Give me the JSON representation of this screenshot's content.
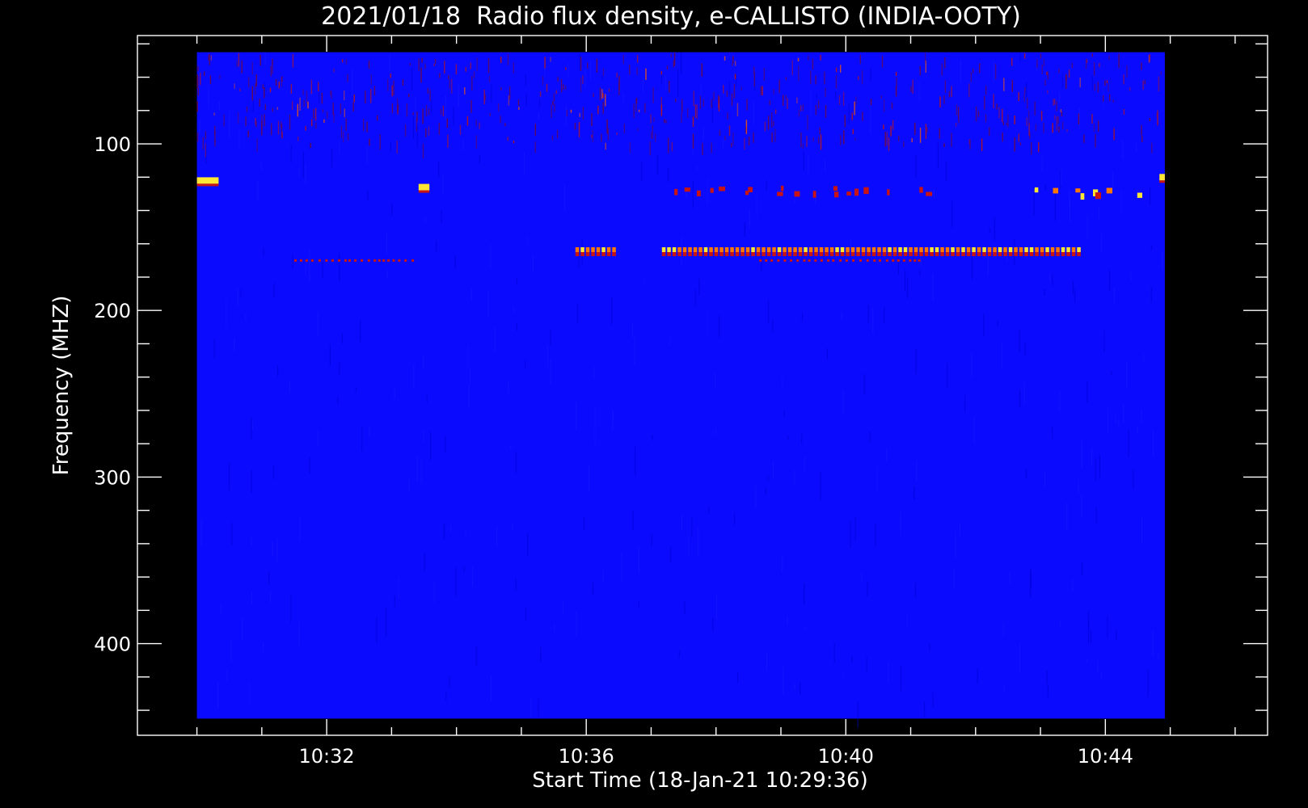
{
  "chart_data": {
    "type": "heatmap",
    "title": "2021/01/18  Radio flux density, e-CALLISTO (INDIA-OOTY)",
    "xlabel": "Start Time (18-Jan-21 10:29:36)",
    "ylabel": "Frequency (MHZ)",
    "x_unit": "UT time",
    "x_data_range": [
      "10:30:00",
      "10:44:55"
    ],
    "xlim": [
      "10:29:05",
      "10:46:30"
    ],
    "x_major_ticks": [
      "10:32",
      "10:36",
      "10:40",
      "10:44"
    ],
    "y_data_range": [
      45,
      445
    ],
    "ylim": [
      35,
      455
    ],
    "y_inverted": true,
    "y_major_ticks": [
      100,
      200,
      300,
      400
    ],
    "colormap": {
      "background": "#0a0aff",
      "low": "#0000c8",
      "mid": "#c81414",
      "high": "#ff7800",
      "peak": "#ffe632"
    },
    "features": [
      {
        "label": "narrowband emission band",
        "freq_mhz": 165,
        "time_start": "10:35:50",
        "time_end": "10:36:25",
        "intensity": "high"
      },
      {
        "label": "narrowband emission band",
        "freq_mhz": 165,
        "time_start": "10:37:10",
        "time_end": "10:43:35",
        "intensity": "peak"
      },
      {
        "label": "faint line",
        "freq_mhz": 170,
        "time_start": "10:31:30",
        "time_end": "10:33:20",
        "intensity": "mid"
      },
      {
        "label": "faint line",
        "freq_mhz": 170,
        "time_start": "10:38:40",
        "time_end": "10:41:10",
        "intensity": "mid"
      },
      {
        "label": "intermittent patches",
        "freq_mhz": 127,
        "time_start": "10:37:20",
        "time_end": "10:41:30",
        "intensity": "mid"
      },
      {
        "label": "intermittent patches",
        "freq_mhz": 128,
        "time_start": "10:42:50",
        "time_end": "10:44:45",
        "intensity": "high"
      },
      {
        "label": "isolated spot",
        "freq_mhz": 122,
        "time_start": "10:30:00",
        "time_end": "10:30:20",
        "intensity": "peak"
      },
      {
        "label": "isolated spot",
        "freq_mhz": 126,
        "time_start": "10:33:25",
        "time_end": "10:33:35",
        "intensity": "peak"
      },
      {
        "label": "isolated spot",
        "freq_mhz": 120,
        "time_start": "10:44:50",
        "time_end": "10:44:55",
        "intensity": "peak"
      },
      {
        "label": "broadband interference",
        "freq_range_mhz": [
          45,
          100
        ],
        "time_start": "10:30:00",
        "time_end": "10:44:55",
        "intensity": "low"
      }
    ]
  }
}
